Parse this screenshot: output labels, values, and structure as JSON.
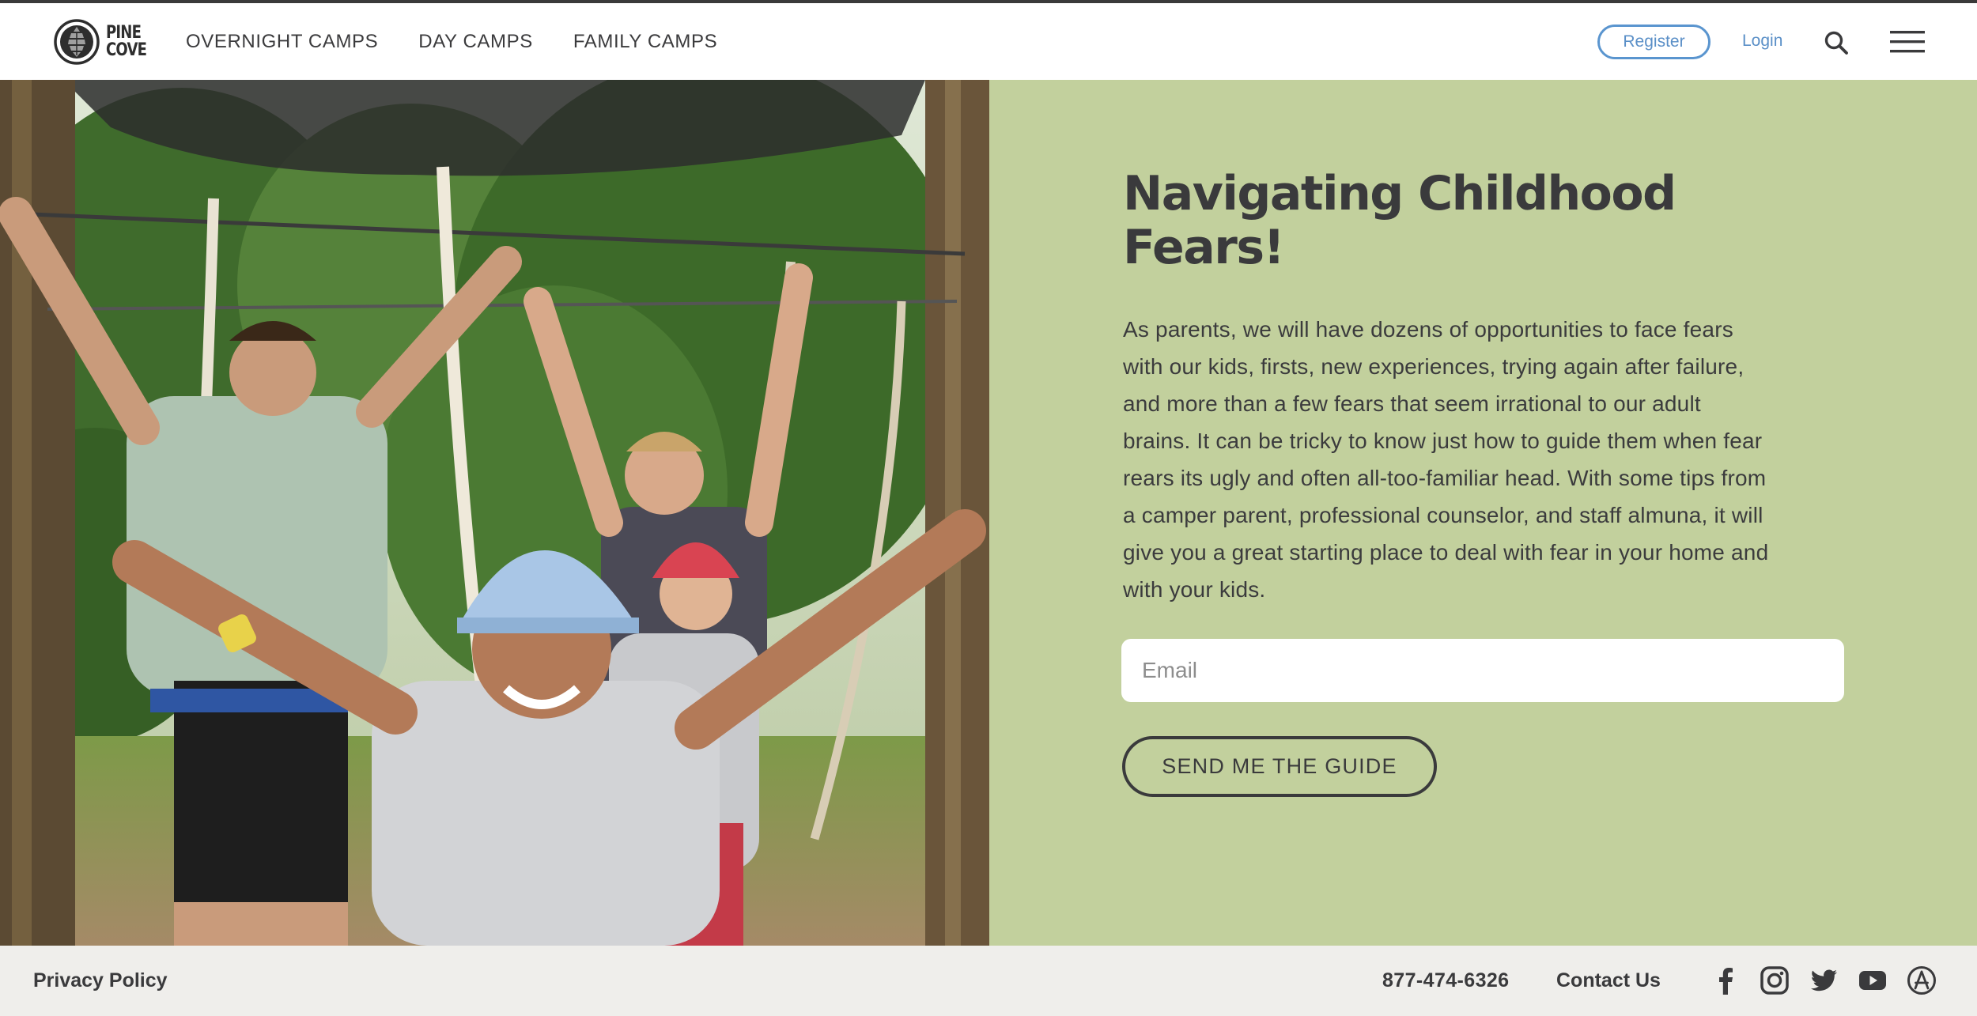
{
  "header": {
    "logo_text": [
      "PINE",
      "COVE"
    ],
    "nav": [
      "OVERNIGHT CAMPS",
      "DAY CAMPS",
      "FAMILY CAMPS"
    ],
    "register_label": "Register",
    "login_label": "Login",
    "icons": [
      "search-icon",
      "hamburger-menu-icon"
    ]
  },
  "hero": {
    "image_subject": "campers in helmets on a ropes course with arms raised"
  },
  "main": {
    "title_line1": "Navigating Childhood",
    "title_line2": "Fears!",
    "body_lines": [
      "As parents, we will have dozens of opportunities to face fears",
      "with our kids, firsts, new experiences, trying again after failure,",
      "and more than a few fears that seem irrational to our adult",
      "brains. It can be tricky to know just how to guide them when fear",
      "rears its ugly and often all-too-familiar head. With some tips from",
      "a camper parent, professional counselor, and staff almuna, it will",
      "give you a great starting place to deal with fear in your home and",
      "with your kids."
    ],
    "email_placeholder": "Email",
    "email_value": "",
    "submit_label": "SEND ME THE GUIDE"
  },
  "footer": {
    "privacy_label": "Privacy Policy",
    "phone": "877-474-6326",
    "contact_label": "Contact Us",
    "social_icons": [
      "facebook-icon",
      "instagram-icon",
      "twitter-icon",
      "youtube-icon",
      "app-store-icon"
    ]
  },
  "colors": {
    "panel_bg": "#c2d09d",
    "accent_blue": "#5a8fc7",
    "text_dark": "#3a3a3c",
    "footer_bg": "#efeeeb"
  }
}
